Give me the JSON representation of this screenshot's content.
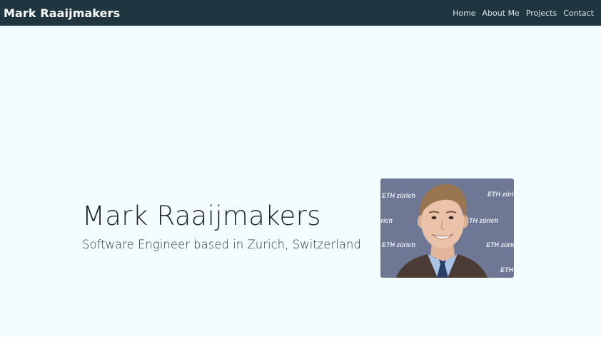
{
  "navbar": {
    "brand": "Mark Raaijmakers",
    "links": [
      {
        "label": "Home"
      },
      {
        "label": "About Me"
      },
      {
        "label": "Projects"
      },
      {
        "label": "Contact"
      }
    ]
  },
  "hero": {
    "name": "Mark Raaijmakers",
    "subtitle": "Software Engineer based in Zurich, Switzerland",
    "photo": {
      "backdrop_text": "ETH zürich"
    }
  },
  "colors": {
    "navbar_bg": "#1f3540",
    "page_bg": "#f3fcff",
    "backdrop": "#6e7895"
  }
}
